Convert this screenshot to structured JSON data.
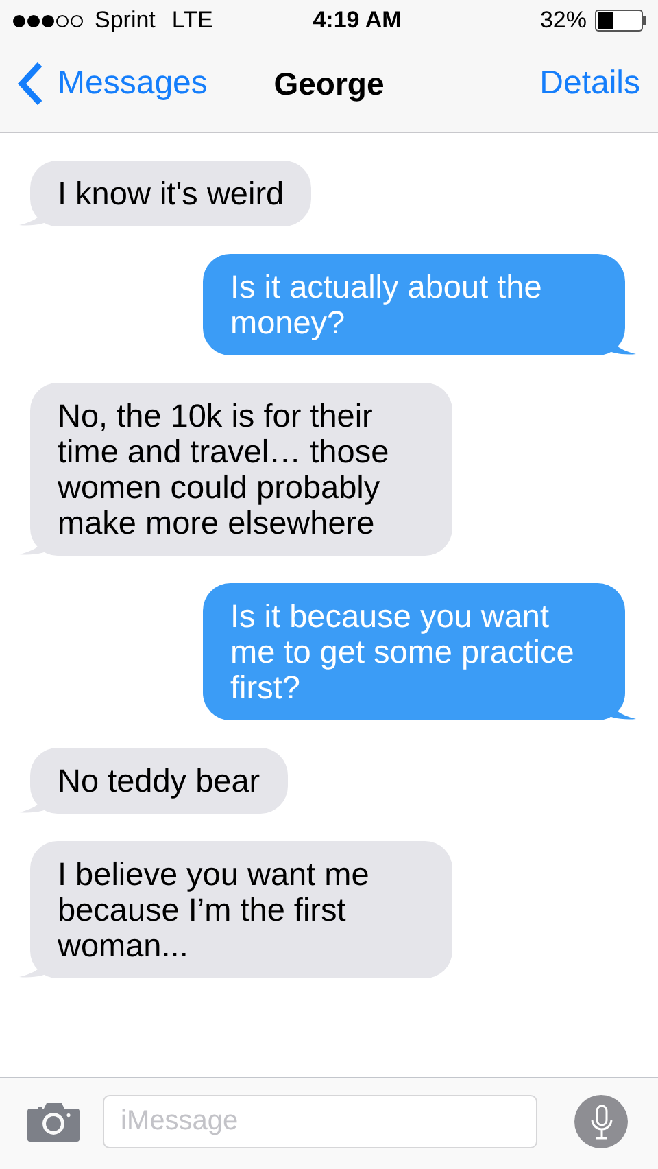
{
  "status_bar": {
    "carrier": "Sprint",
    "network": "LTE",
    "time": "4:19 AM",
    "battery": "32%"
  },
  "nav": {
    "back": "Messages",
    "title": "George",
    "action": "Details"
  },
  "messages": [
    {
      "kind": "received",
      "text": "I know it's weird"
    },
    {
      "kind": "sent",
      "text": "Is it actually about the money?"
    },
    {
      "kind": "received",
      "text": "No, the 10k is for their time and travel… those women could probably make more elsewhere"
    },
    {
      "kind": "sent",
      "text": "Is it because you want me to get some practice first?"
    },
    {
      "kind": "received",
      "text": "No teddy bear"
    },
    {
      "kind": "received",
      "text": "I believe you want me because I’m the first woman..."
    }
  ],
  "composer": {
    "placeholder": "iMessage"
  }
}
